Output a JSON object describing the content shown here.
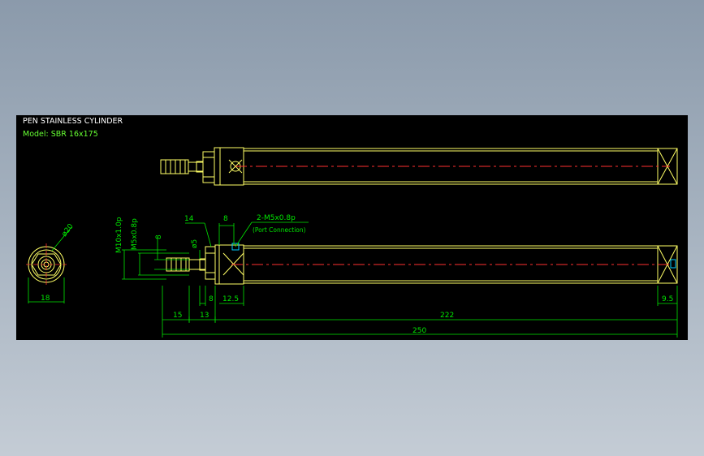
{
  "title": "PEN STAINLESS CYLINDER",
  "model": "Model: SBR 16x175",
  "colors": {
    "background": "#000000",
    "outline": "#ffff66",
    "centerline": "#ff3030",
    "dimension": "#00e600",
    "title_text": "#ffffff",
    "model_text": "#66ff33",
    "viewport": "#9aa8b8"
  },
  "dimensions": {
    "d_20": "ø20",
    "d_18": "18",
    "m10": "M10x1.0p",
    "m5": "M5x0.8p",
    "d_8_rod": "8",
    "d_5": "ø5",
    "d_14": "14",
    "d_8_port": "8",
    "port_thread": "2-M5x0.8p",
    "port_note": "(Port Connection)",
    "d_15": "15",
    "d_13": "13",
    "d_8_bottom": "8",
    "d_12_5": "12.5",
    "d_222": "222",
    "d_9_5": "9.5",
    "d_250": "250"
  }
}
